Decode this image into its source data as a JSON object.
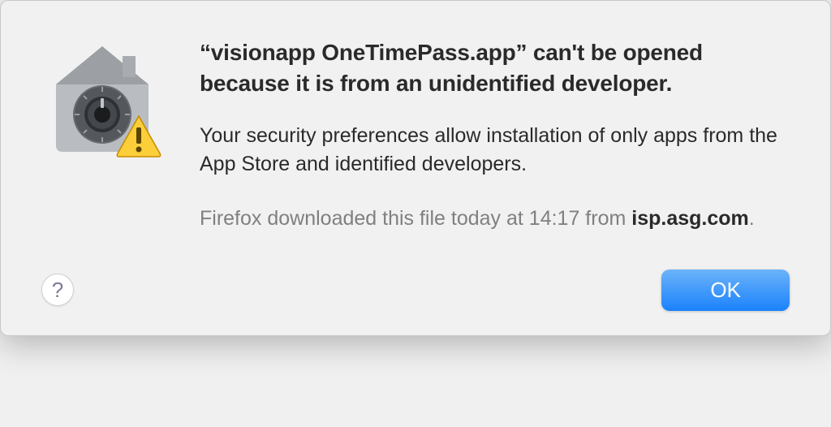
{
  "dialog": {
    "title": "“visionapp OneTimePass.app” can't be opened because it is from an unidentified developer.",
    "message": "Your security preferences allow installation of only apps from the App Store and identified developers.",
    "source_prefix": "Firefox downloaded this file today at 14:17 from ",
    "source_domain": "isp.asg.com",
    "source_suffix": "."
  },
  "buttons": {
    "help_label": "?",
    "ok_label": "OK"
  },
  "icon": {
    "name": "security-gatekeeper-with-warning"
  }
}
